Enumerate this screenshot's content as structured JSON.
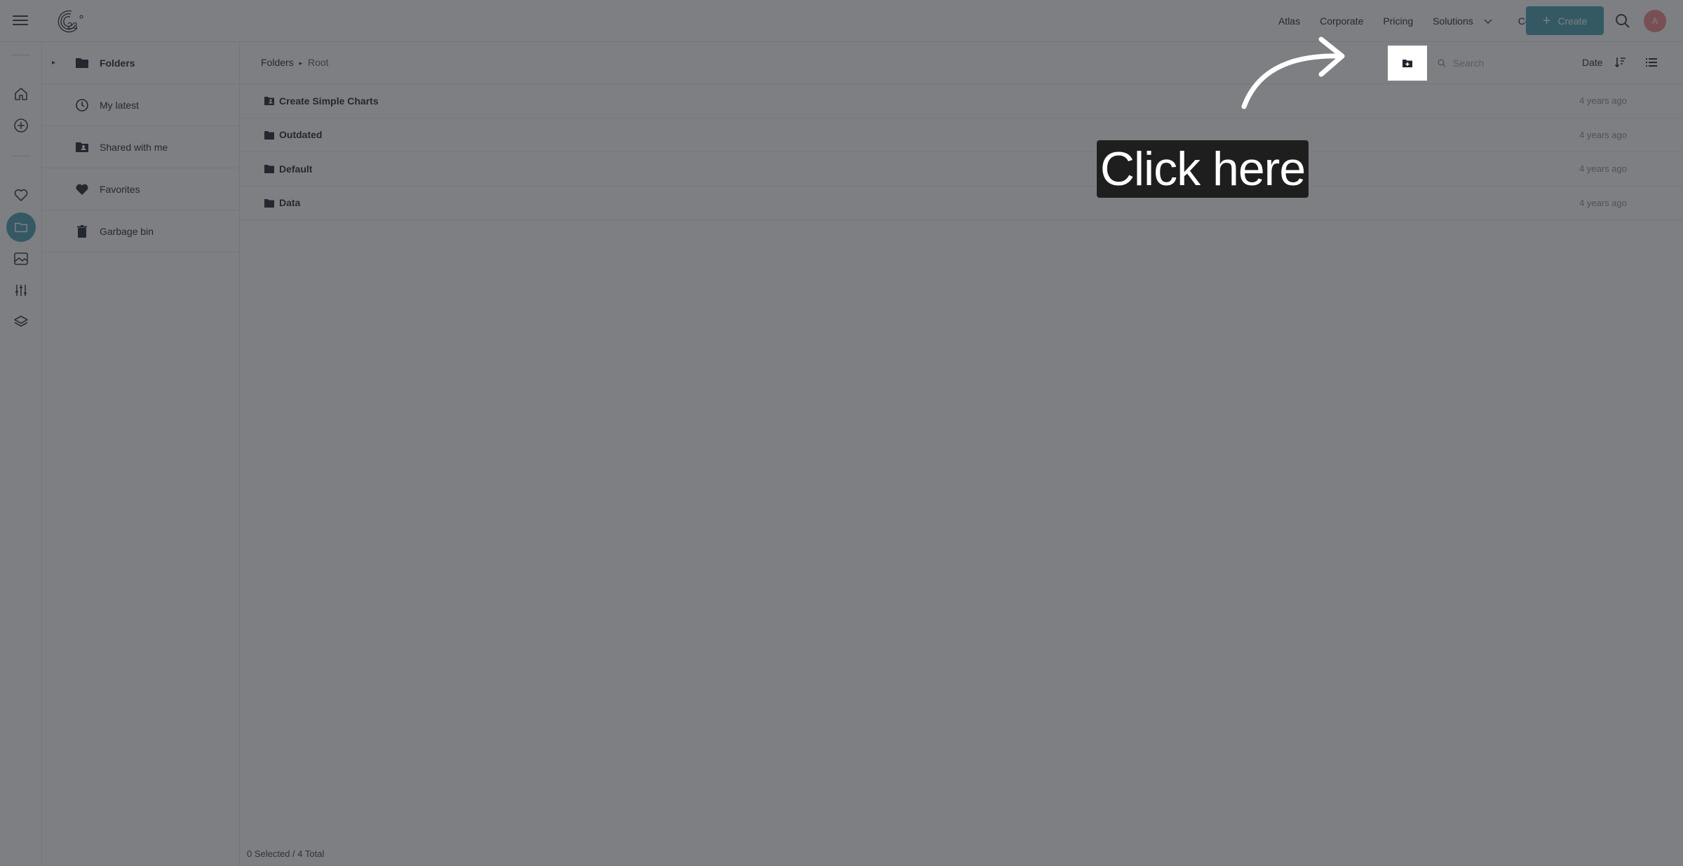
{
  "topbar": {
    "menu_icon": "hamburger-menu-icon",
    "logo_icon": "23-degrees-logo",
    "nav": [
      "Atlas",
      "Corporate",
      "Pricing",
      "Solutions",
      "Contact Us"
    ],
    "create_label": "Create",
    "avatar_initial": "A",
    "accent_color": "#4aa0b1"
  },
  "rail": {
    "icons": [
      "home-icon",
      "add-circle-icon",
      "heart-icon",
      "folder-icon",
      "image-icon",
      "sliders-icon",
      "layers-icon"
    ],
    "active": "folder-icon"
  },
  "sidebar": {
    "items": [
      {
        "label": "Folders",
        "icon": "folder-icon"
      },
      {
        "label": "My latest",
        "icon": "clock-icon"
      },
      {
        "label": "Shared with me",
        "icon": "shared-folder-icon"
      },
      {
        "label": "Favorites",
        "icon": "heart-icon"
      },
      {
        "label": "Garbage bin",
        "icon": "trash-icon"
      }
    ]
  },
  "toolbar": {
    "breadcrumb_folders": "Folders",
    "breadcrumb_root": "Root",
    "search_placeholder": "Search",
    "sort_label": "Date"
  },
  "folders": [
    {
      "name": "Create Simple Charts",
      "date": "4 years ago",
      "icon": "shared-folder-icon"
    },
    {
      "name": "Outdated",
      "date": "4 years ago",
      "icon": "folder-icon"
    },
    {
      "name": "Default",
      "date": "4 years ago",
      "icon": "folder-icon"
    },
    {
      "name": "Data",
      "date": "4 years ago",
      "icon": "folder-icon"
    }
  ],
  "status": "0 Selected / 4 Total",
  "tutorial": {
    "callout_text": "Click here",
    "highlight_icon": "new-folder-icon"
  }
}
